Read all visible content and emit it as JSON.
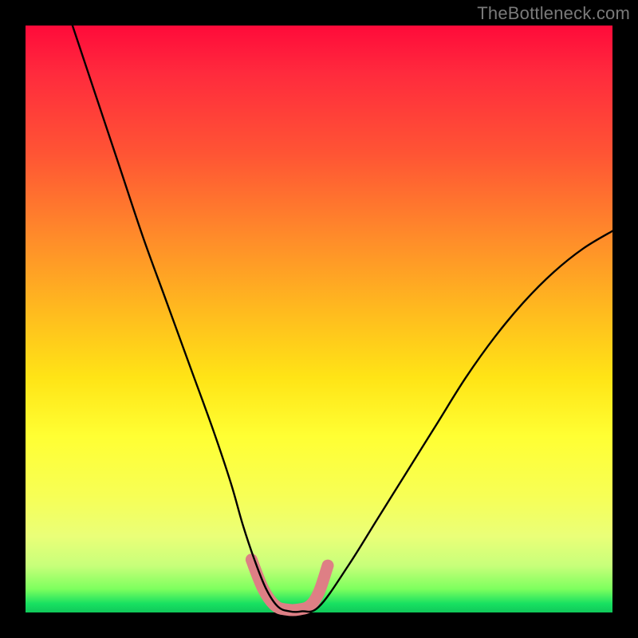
{
  "watermark": "TheBottleneck.com",
  "chart_data": {
    "type": "line",
    "title": "",
    "xlabel": "",
    "ylabel": "",
    "xlim": [
      0,
      100
    ],
    "ylim": [
      0,
      100
    ],
    "series": [
      {
        "name": "bottleneck-curve",
        "x": [
          8,
          12,
          16,
          20,
          24,
          28,
          32,
          35,
          37,
          39,
          41,
          43,
          45,
          47,
          50,
          55,
          60,
          65,
          70,
          75,
          80,
          85,
          90,
          95,
          100
        ],
        "y": [
          100,
          88,
          76,
          64,
          53,
          42,
          31,
          22,
          15,
          9,
          4,
          1,
          0.2,
          0.2,
          1,
          8,
          16,
          24,
          32,
          40,
          47,
          53,
          58,
          62,
          65
        ]
      }
    ],
    "annotations": [
      {
        "name": "optimal-band-marker",
        "type": "path",
        "points_x": [
          38.5,
          40.5,
          42.5,
          44.5,
          46.5,
          48.5,
          50.0,
          51.5
        ],
        "points_y": [
          9.0,
          4.0,
          1.2,
          0.5,
          0.5,
          1.2,
          3.5,
          8.0
        ],
        "stroke": "#de7f85",
        "stroke_width_px": 15
      }
    ],
    "gradient_stops": [
      {
        "pos": 0.0,
        "color": "#ff0a3a"
      },
      {
        "pos": 0.22,
        "color": "#ff5534"
      },
      {
        "pos": 0.48,
        "color": "#ffb81f"
      },
      {
        "pos": 0.7,
        "color": "#ffff33"
      },
      {
        "pos": 0.92,
        "color": "#c8ff7a"
      },
      {
        "pos": 1.0,
        "color": "#10c95a"
      }
    ]
  }
}
